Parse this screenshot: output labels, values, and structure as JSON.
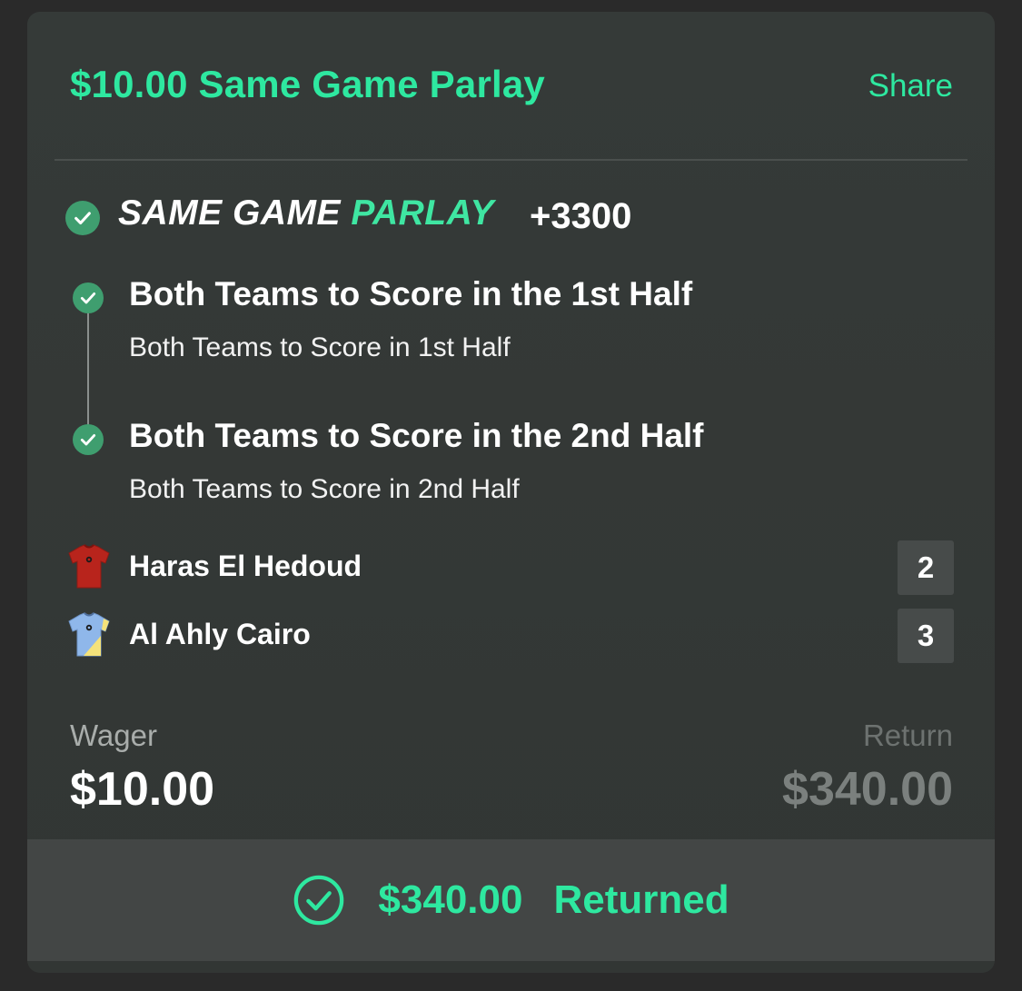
{
  "header": {
    "title": "$10.00 Same Game Parlay",
    "share_label": "Share"
  },
  "parlay": {
    "logo_word1": "SAME GAME",
    "logo_word2": "PARLAY",
    "odds": "+3300",
    "status_icon": "check-circle-icon"
  },
  "legs": [
    {
      "title": "Both Teams to Score in the 1st Half",
      "subtitle": "Both Teams to Score in 1st Half",
      "status_icon": "check-circle-icon"
    },
    {
      "title": "Both Teams to Score in the 2nd Half",
      "subtitle": "Both Teams to Score in 2nd Half",
      "status_icon": "check-circle-icon"
    }
  ],
  "teams": [
    {
      "name": "Haras El Hedoud",
      "score": "2",
      "jersey_icon": "red-jersey-icon"
    },
    {
      "name": "Al Ahly Cairo",
      "score": "3",
      "jersey_icon": "blue-yellow-jersey-icon"
    }
  ],
  "summary": {
    "wager_label": "Wager",
    "wager_value": "$10.00",
    "return_label": "Return",
    "return_value": "$340.00"
  },
  "footer": {
    "amount": "$340.00",
    "label": "Returned",
    "icon": "check-circle-outline-icon"
  },
  "colors": {
    "accent": "#2ee8a0",
    "check_green": "#3f9e6f",
    "card_bg": "#353a38",
    "footer_bg": "#434645"
  }
}
